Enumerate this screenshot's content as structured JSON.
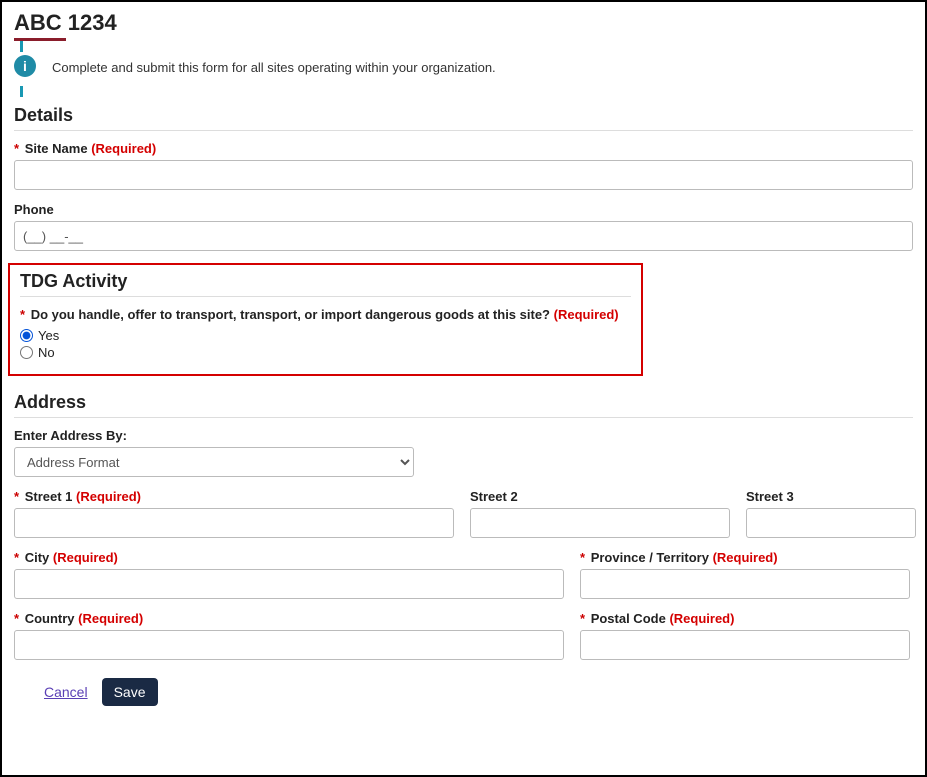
{
  "page": {
    "title": "ABC 1234",
    "info_message": "Complete and submit this form for all sites operating within your organization."
  },
  "required_text": "(Required)",
  "details": {
    "heading": "Details",
    "site_name": {
      "label": "Site Name",
      "value": ""
    },
    "phone": {
      "label": "Phone",
      "value": "(__) __-__"
    }
  },
  "tdg": {
    "heading": "TDG Activity",
    "question": "Do you handle, offer to transport, transport, or import dangerous goods at this site?",
    "yes": "Yes",
    "no": "No",
    "selected": "yes"
  },
  "address": {
    "heading": "Address",
    "enter_by_label": "Enter Address By:",
    "format_placeholder": "Address Format",
    "street1": "Street 1",
    "street2": "Street 2",
    "street3": "Street 3",
    "city": "City",
    "province": "Province / Territory",
    "country": "Country",
    "postal": "Postal Code"
  },
  "actions": {
    "cancel": "Cancel",
    "save": "Save"
  },
  "icons": {
    "info_glyph": "i"
  }
}
